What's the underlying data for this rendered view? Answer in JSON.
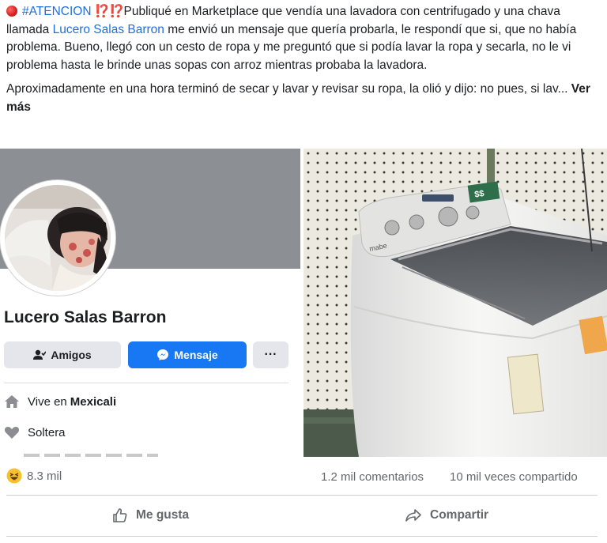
{
  "post": {
    "hashtag": "#ATENCION",
    "excl_marks": "⁉️⁉️",
    "text_part1": "Publiqué en Marketplace que vendía una lavadora con centrifugado y una chava llamada ",
    "mention": "Lucero Salas Barron",
    "text_part2": " me envió un mensaje que quería probarla, le respondí que si, que no había problema. Bueno, llegó con un cesto de ropa y me preguntó que si podía lavar la ropa y secarla, no le vi problema hasta le brinde unas sopas con arroz mientras probaba la lavadora.",
    "paragraph2": "Aproximadamente en una hora terminó de secar y lavar y revisar su ropa, la olió y dijo: no pues, si lav...",
    "see_more": "Ver más"
  },
  "profile_card": {
    "name": "Lucero Salas Barron",
    "friends_button": "Amigos",
    "message_button": "Mensaje",
    "more_button": "···",
    "lives_prefix": "Vive en",
    "lives_city": "Mexicali",
    "relationship": "Soltera"
  },
  "washer": {
    "brand_label": "mabe",
    "price_tag": "$$"
  },
  "stats": {
    "reactions": "8.3 mil",
    "comments": "1.2 mil comentarios",
    "shares": "10 mil veces compartido"
  },
  "actions": {
    "like": "Me gusta",
    "share": "Compartir"
  },
  "colors": {
    "link": "#216fdb",
    "facebook_blue": "#1877f2",
    "secondary_text": "#65676b"
  }
}
